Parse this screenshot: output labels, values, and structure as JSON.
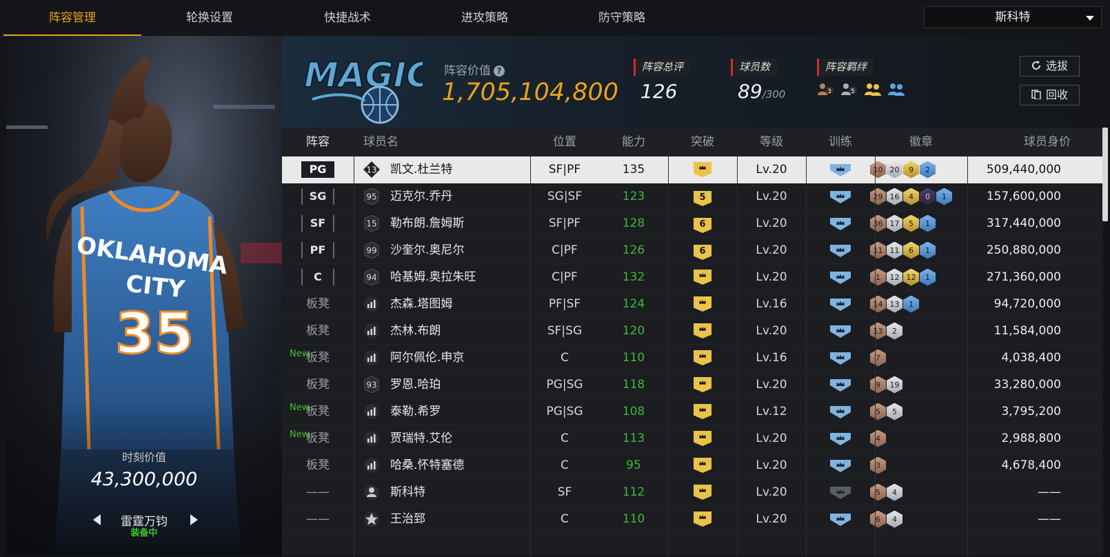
{
  "tabs": [
    "阵容管理",
    "轮换设置",
    "快捷战术",
    "进攻策略",
    "防守策略"
  ],
  "active_tab": 0,
  "coach_select": "斯科特",
  "left_card": {
    "moment_label": "时刻价值",
    "moment_value": "43,300,000",
    "card_name": "雷霆万钧",
    "status": "装备中",
    "jersey_text": "OKLAHOMA CITY",
    "jersey_number": "35"
  },
  "header": {
    "team_logo_text": "MAGIC",
    "lineup_value_label": "阵容价值",
    "lineup_value": "1,705,104,800",
    "overall_label": "阵容总评",
    "overall_value": "126",
    "players_label": "球员数",
    "players_value": "89",
    "players_max": "/300",
    "bond_label": "阵容羁绊",
    "bond_icons": [
      "3",
      "5",
      "",
      ""
    ],
    "select_btn": "选拔",
    "recycle_btn": "回收"
  },
  "table": {
    "columns": [
      "阵容",
      "球员名",
      "位置",
      "能力",
      "突破",
      "等级",
      "训练",
      "徽章",
      "球员身价"
    ],
    "rows": [
      {
        "slot": "PG",
        "is_bench": false,
        "new": "",
        "num": "13",
        "icon": "diamond",
        "name": "凯文.杜兰特",
        "pos": "SF|PF",
        "ability": "135",
        "ability_green": false,
        "breakthrough": "crown",
        "level": "Lv.20",
        "train": "blue",
        "badges": [
          [
            "bronze",
            "10"
          ],
          [
            "silver",
            "20"
          ],
          [
            "gold",
            "9"
          ],
          [
            "blue",
            "2"
          ]
        ],
        "worth": "509,440,000"
      },
      {
        "slot": "SG",
        "is_bench": false,
        "new": "",
        "num": "95",
        "icon": "hex",
        "name": "迈克尔.乔丹",
        "pos": "SG|SF",
        "ability": "123",
        "ability_green": true,
        "breakthrough": "5",
        "level": "Lv.20",
        "train": "blue",
        "badges": [
          [
            "bronze",
            "29"
          ],
          [
            "silver",
            "16"
          ],
          [
            "gold",
            "4"
          ],
          [
            "purple",
            "0"
          ],
          [
            "blue",
            "1"
          ]
        ],
        "worth": "157,600,000"
      },
      {
        "slot": "SF",
        "is_bench": false,
        "new": "",
        "num": "15",
        "icon": "hex",
        "name": "勒布朗.詹姆斯",
        "pos": "SF|PF",
        "ability": "128",
        "ability_green": true,
        "breakthrough": "6",
        "level": "Lv.20",
        "train": "blue",
        "badges": [
          [
            "bronze",
            "36"
          ],
          [
            "silver",
            "17"
          ],
          [
            "gold",
            "5"
          ],
          [
            "blue",
            "1"
          ]
        ],
        "worth": "317,440,000"
      },
      {
        "slot": "PF",
        "is_bench": false,
        "new": "",
        "num": "99",
        "icon": "hex",
        "name": "沙奎尔.奥尼尔",
        "pos": "C|PF",
        "ability": "126",
        "ability_green": true,
        "breakthrough": "6",
        "level": "Lv.20",
        "train": "blue",
        "badges": [
          [
            "bronze",
            "11"
          ],
          [
            "silver",
            "11"
          ],
          [
            "gold",
            "6"
          ],
          [
            "blue",
            "1"
          ]
        ],
        "worth": "250,880,000"
      },
      {
        "slot": "C",
        "is_bench": false,
        "new": "",
        "num": "94",
        "icon": "hex",
        "name": "哈基姆.奥拉朱旺",
        "pos": "C|PF",
        "ability": "132",
        "ability_green": true,
        "breakthrough": "crown",
        "level": "Lv.20",
        "train": "blue",
        "badges": [
          [
            "bronze",
            "1"
          ],
          [
            "silver",
            "12"
          ],
          [
            "gold",
            "12"
          ],
          [
            "blue",
            "1"
          ]
        ],
        "worth": "271,360,000"
      },
      {
        "slot": "板凳",
        "is_bench": true,
        "new": "",
        "num": "",
        "icon": "bars",
        "name": "杰森.塔图姆",
        "pos": "PF|SF",
        "ability": "124",
        "ability_green": true,
        "breakthrough": "crown",
        "level": "Lv.16",
        "train": "blue",
        "badges": [
          [
            "bronze",
            "14"
          ],
          [
            "silver",
            "13"
          ],
          [
            "blue",
            "1"
          ]
        ],
        "worth": "94,720,000"
      },
      {
        "slot": "板凳",
        "is_bench": true,
        "new": "",
        "num": "",
        "icon": "bars",
        "name": "杰林.布朗",
        "pos": "SF|SG",
        "ability": "120",
        "ability_green": true,
        "breakthrough": "crown",
        "level": "Lv.20",
        "train": "blue",
        "badges": [
          [
            "bronze",
            "13"
          ],
          [
            "silver",
            "2"
          ]
        ],
        "worth": "11,584,000"
      },
      {
        "slot": "板凳",
        "is_bench": true,
        "new": "New",
        "num": "",
        "icon": "bars",
        "name": "阿尔佩伦.申京",
        "pos": "C",
        "ability": "110",
        "ability_green": true,
        "breakthrough": "crown",
        "level": "Lv.16",
        "train": "blue",
        "badges": [
          [
            "bronze",
            "7"
          ]
        ],
        "worth": "4,038,400"
      },
      {
        "slot": "板凳",
        "is_bench": true,
        "new": "",
        "num": "93",
        "icon": "hex",
        "name": "罗恩.哈珀",
        "pos": "PG|SG",
        "ability": "118",
        "ability_green": true,
        "breakthrough": "crown",
        "level": "Lv.20",
        "train": "blue",
        "badges": [
          [
            "bronze",
            "9"
          ],
          [
            "silver",
            "19"
          ]
        ],
        "worth": "33,280,000"
      },
      {
        "slot": "板凳",
        "is_bench": true,
        "new": "New",
        "num": "",
        "icon": "bars",
        "name": "泰勒.希罗",
        "pos": "PG|SG",
        "ability": "108",
        "ability_green": true,
        "breakthrough": "crown",
        "level": "Lv.12",
        "train": "blue",
        "badges": [
          [
            "bronze",
            "5"
          ],
          [
            "silver",
            "5"
          ]
        ],
        "worth": "3,795,200"
      },
      {
        "slot": "板凳",
        "is_bench": true,
        "new": "New",
        "num": "",
        "icon": "bars",
        "name": "贾瑞特.艾伦",
        "pos": "C",
        "ability": "113",
        "ability_green": true,
        "breakthrough": "crown",
        "level": "Lv.20",
        "train": "blue",
        "badges": [
          [
            "bronze",
            "4"
          ]
        ],
        "worth": "2,988,800"
      },
      {
        "slot": "板凳",
        "is_bench": true,
        "new": "",
        "num": "",
        "icon": "bars",
        "name": "哈桑.怀特塞德",
        "pos": "C",
        "ability": "95",
        "ability_green": true,
        "breakthrough": "crown",
        "level": "Lv.20",
        "train": "blue",
        "badges": [
          [
            "bronze",
            "3"
          ]
        ],
        "worth": "4,678,400"
      },
      {
        "slot": "——",
        "is_bench": true,
        "new": "",
        "num": "",
        "icon": "person",
        "name": "斯科特",
        "pos": "SF",
        "ability": "112",
        "ability_green": true,
        "breakthrough": "crown",
        "level": "Lv.20",
        "train": "gray",
        "badges": [
          [
            "bronze",
            "5"
          ],
          [
            "silver",
            "4"
          ]
        ],
        "worth": "——"
      },
      {
        "slot": "——",
        "is_bench": true,
        "new": "",
        "num": "",
        "icon": "star",
        "name": "王治郅",
        "pos": "C",
        "ability": "110",
        "ability_green": true,
        "breakthrough": "crown",
        "level": "Lv.20",
        "train": "blue",
        "badges": [
          [
            "bronze",
            "6"
          ],
          [
            "silver",
            "4"
          ]
        ],
        "worth": "——"
      }
    ]
  },
  "colors": {
    "accent": "#e8a21c",
    "green": "#3fb83a",
    "red": "#d52a2a"
  }
}
